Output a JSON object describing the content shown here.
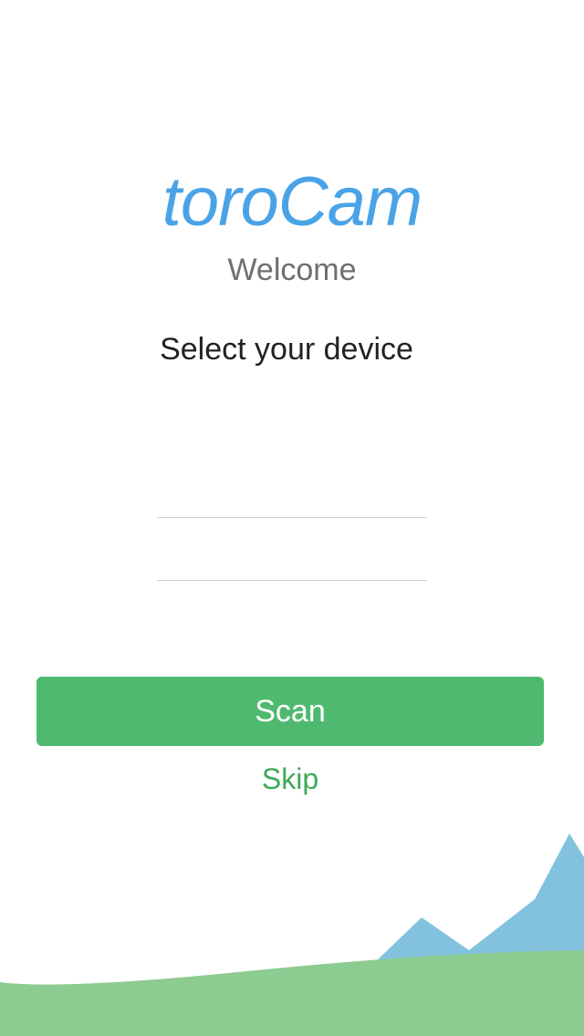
{
  "app": {
    "logo_text": "toroCam",
    "welcome_text": "Welcome",
    "instruction": "Select your device"
  },
  "actions": {
    "scan_label": "Scan",
    "skip_label": "Skip"
  },
  "colors": {
    "brand_blue": "#4aa3e6",
    "button_green": "#4fba6f",
    "link_green": "#3fa85a",
    "hill_green": "#8dcc90",
    "mountain_blue": "#82c2df"
  }
}
